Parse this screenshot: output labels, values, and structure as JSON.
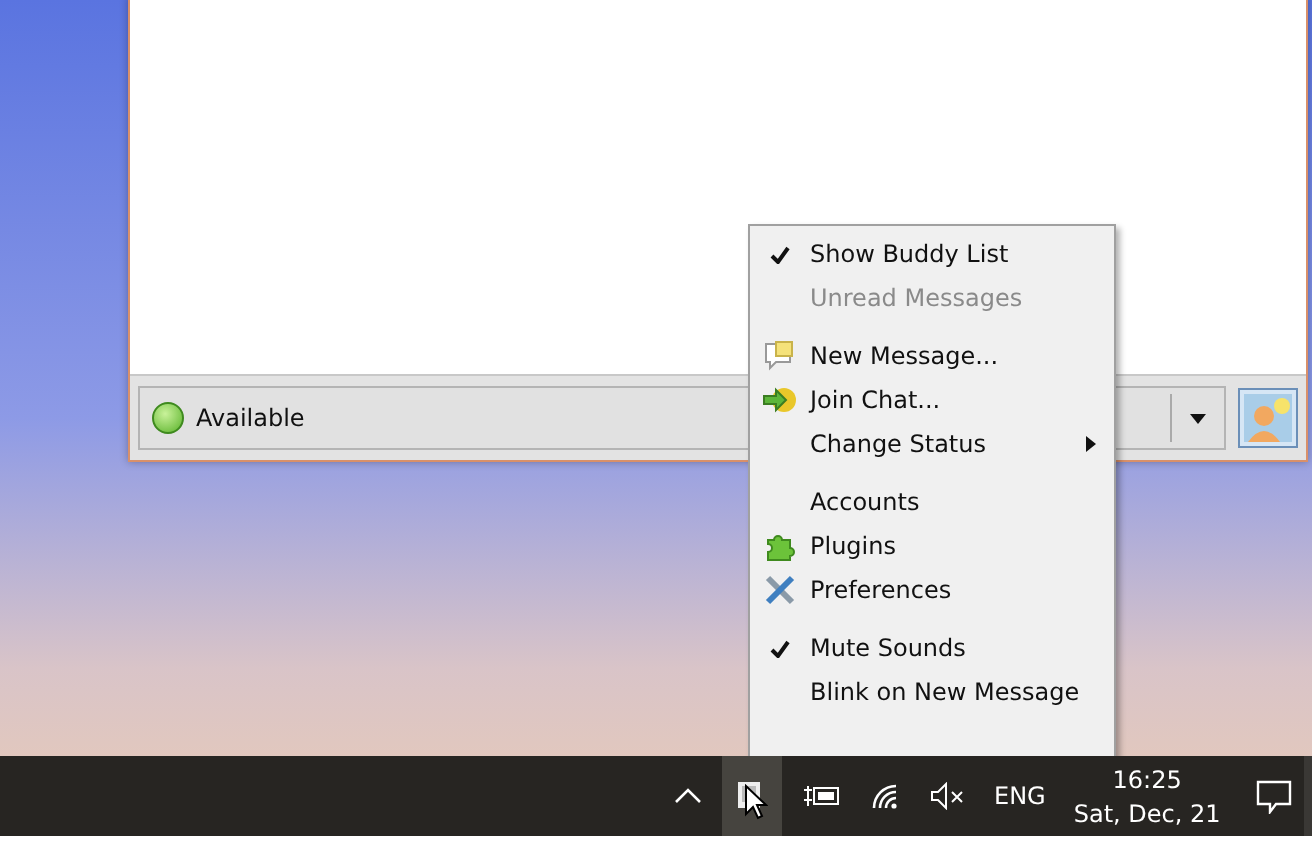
{
  "buddy_window": {
    "status": {
      "label": "Available"
    }
  },
  "tray_menu": {
    "groups": [
      [
        {
          "label": "Show Buddy List",
          "kind": "check",
          "checked": true,
          "disabled": false,
          "submenu": false
        },
        {
          "label": "Unread Messages",
          "kind": "check",
          "checked": false,
          "disabled": true,
          "submenu": false
        }
      ],
      [
        {
          "label": "New Message...",
          "kind": "new-message",
          "disabled": false,
          "submenu": false
        },
        {
          "label": "Join Chat...",
          "kind": "join-chat",
          "disabled": false,
          "submenu": false
        },
        {
          "label": "Change Status",
          "kind": "plain",
          "disabled": false,
          "submenu": true
        }
      ],
      [
        {
          "label": "Accounts",
          "kind": "plain",
          "disabled": false,
          "submenu": false
        },
        {
          "label": "Plugins",
          "kind": "plugins",
          "disabled": false,
          "submenu": false
        },
        {
          "label": "Preferences",
          "kind": "preferences",
          "disabled": false,
          "submenu": false
        }
      ],
      [
        {
          "label": "Mute Sounds",
          "kind": "check",
          "checked": true,
          "disabled": false,
          "submenu": false
        },
        {
          "label": "Blink on New Message",
          "kind": "check",
          "checked": false,
          "disabled": false,
          "submenu": false
        }
      ]
    ]
  },
  "taskbar": {
    "language": "ENG",
    "time": "16:25",
    "date": "Sat, Dec, 21"
  }
}
